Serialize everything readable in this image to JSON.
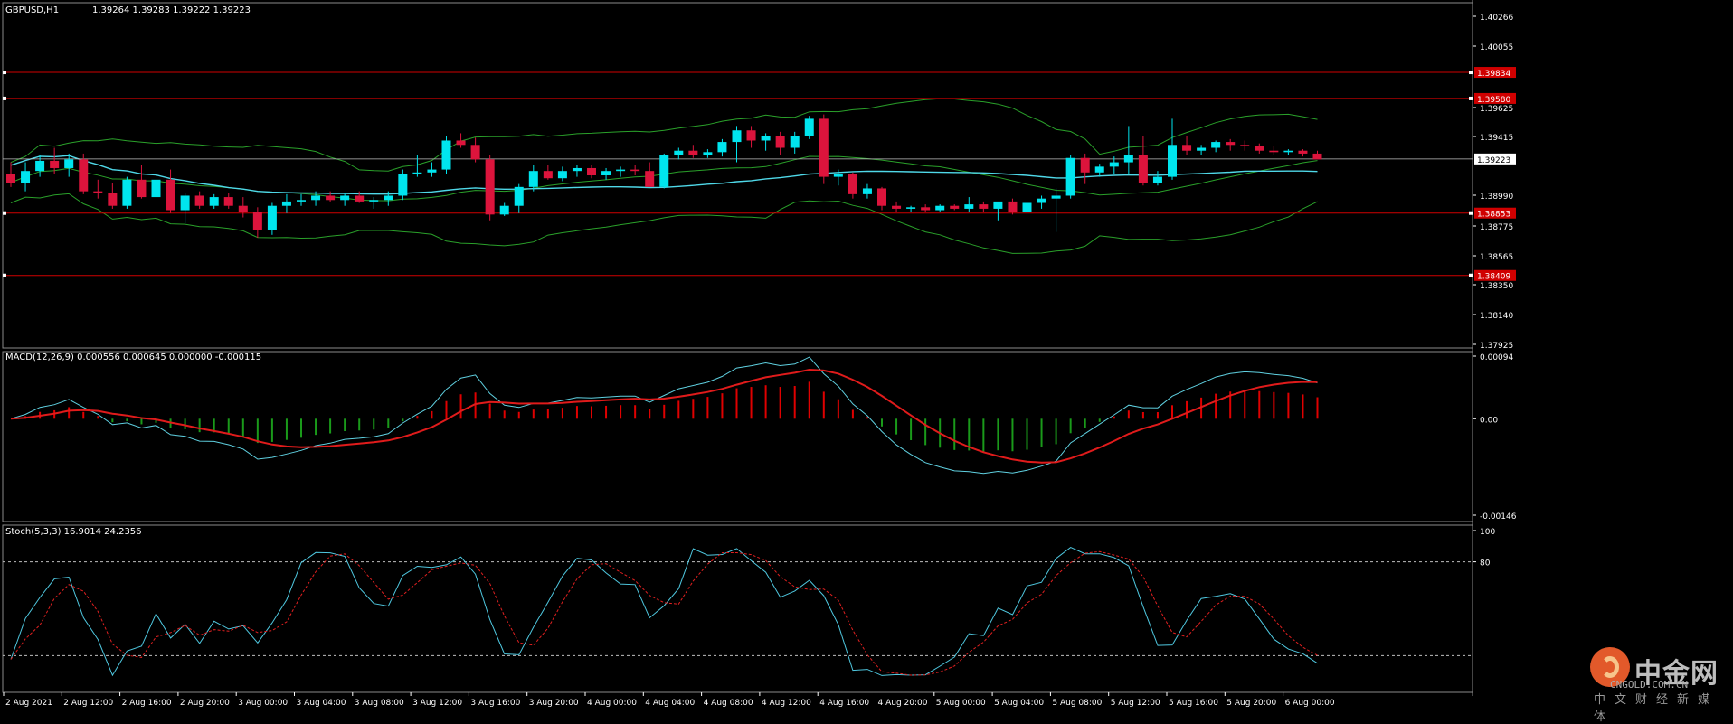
{
  "colors": {
    "background": "#000000",
    "bull": "#00e5ee",
    "bear": "#dc143c",
    "grid": "#1c1c1c",
    "bands": "#2aa02a",
    "ma": "#4fd8e8",
    "level": "#d00000",
    "price_line": "#c0c0c0",
    "macd_line": "#5fd0e0",
    "signal_line": "#e01b1b",
    "hist_pos": "#e00000",
    "hist_neg": "#1a9a1a",
    "stoch_main": "#4fc8e0",
    "stoch_signal": "#e02020"
  },
  "main_header": {
    "symbol": "GBPUSD,H1",
    "ohlc": "1.39264 1.39283 1.39222 1.39223"
  },
  "price_axis": {
    "ticks": [
      "1.40266",
      "1.40055",
      "1.39625",
      "1.39415",
      "1.38990",
      "1.38775",
      "1.38565",
      "1.38350",
      "1.38140",
      "1.37925"
    ],
    "current": "1.39223"
  },
  "levels": [
    {
      "value": 1.3982,
      "label": "1.39834"
    },
    {
      "value": 1.3964,
      "label": "1.39580"
    },
    {
      "value": 1.3885,
      "label": "1.38853"
    },
    {
      "value": 1.3842,
      "label": "1.38409"
    }
  ],
  "macd_header": {
    "label": "MACD(12,26,9) 0.000556 0.000645 0.000000 -0.000115"
  },
  "macd_axis": {
    "ticks": [
      "0.00094",
      "0.00",
      "-0.00146"
    ]
  },
  "stoch_header": {
    "label": "Stoch(5,3,3) 16.9014 24.2356"
  },
  "stoch_axis": {
    "ticks": [
      "100",
      "80"
    ]
  },
  "time_axis": {
    "labels": [
      "2 Aug 2021",
      "2 Aug 12:00",
      "2 Aug 16:00",
      "2 Aug 20:00",
      "3 Aug 00:00",
      "3 Aug 04:00",
      "3 Aug 08:00",
      "3 Aug 12:00",
      "3 Aug 16:00",
      "3 Aug 20:00",
      "4 Aug 00:00",
      "4 Aug 04:00",
      "4 Aug 08:00",
      "4 Aug 12:00",
      "4 Aug 16:00",
      "4 Aug 20:00",
      "5 Aug 00:00",
      "5 Aug 04:00",
      "5 Aug 08:00",
      "5 Aug 12:00",
      "5 Aug 16:00",
      "5 Aug 20:00",
      "6 Aug 00:00"
    ]
  },
  "watermark": {
    "brand": "中金网",
    "domain": "CNGOLD.COM.CN",
    "tag": "中文财经新媒体"
  },
  "chart_data": {
    "type": "candlestick",
    "symbol": "GBPUSD",
    "timeframe": "H1",
    "ylim": [
      1.3792,
      1.403
    ],
    "candles": [
      [
        1.3912,
        1.392,
        1.3903,
        1.3906
      ],
      [
        1.3906,
        1.392,
        1.39,
        1.3914
      ],
      [
        1.3914,
        1.3925,
        1.391,
        1.3921
      ],
      [
        1.3921,
        1.393,
        1.3912,
        1.3916
      ],
      [
        1.3916,
        1.3926,
        1.391,
        1.3922
      ],
      [
        1.3922,
        1.3926,
        1.3898,
        1.39
      ],
      [
        1.39,
        1.3908,
        1.3895,
        1.3899
      ],
      [
        1.3899,
        1.3906,
        1.3888,
        1.389
      ],
      [
        1.389,
        1.391,
        1.3888,
        1.3908
      ],
      [
        1.3908,
        1.3918,
        1.3895,
        1.3896
      ],
      [
        1.3896,
        1.3915,
        1.3892,
        1.3908
      ],
      [
        1.3908,
        1.3915,
        1.3885,
        1.3887
      ],
      [
        1.3887,
        1.3899,
        1.3878,
        1.3897
      ],
      [
        1.3897,
        1.39,
        1.3888,
        1.389
      ],
      [
        1.389,
        1.3898,
        1.3888,
        1.3896
      ],
      [
        1.3896,
        1.3899,
        1.3888,
        1.389
      ],
      [
        1.389,
        1.3896,
        1.3882,
        1.3886
      ],
      [
        1.3886,
        1.3889,
        1.3868,
        1.3873
      ],
      [
        1.3873,
        1.3892,
        1.387,
        1.389
      ],
      [
        1.389,
        1.3898,
        1.3885,
        1.3893
      ],
      [
        1.3893,
        1.3898,
        1.389,
        1.3894
      ],
      [
        1.3894,
        1.39,
        1.389,
        1.3897
      ],
      [
        1.3897,
        1.39,
        1.3893,
        1.3894
      ],
      [
        1.3894,
        1.3899,
        1.389,
        1.3897
      ],
      [
        1.3897,
        1.39,
        1.3892,
        1.3893
      ],
      [
        1.3893,
        1.3896,
        1.3888,
        1.3894
      ],
      [
        1.3894,
        1.39,
        1.389,
        1.3897
      ],
      [
        1.3897,
        1.3915,
        1.3894,
        1.3912
      ],
      [
        1.3912,
        1.3925,
        1.391,
        1.3913
      ],
      [
        1.3913,
        1.392,
        1.391,
        1.3915
      ],
      [
        1.3915,
        1.3938,
        1.3912,
        1.3935
      ],
      [
        1.3935,
        1.394,
        1.393,
        1.3932
      ],
      [
        1.3932,
        1.3937,
        1.392,
        1.3922
      ],
      [
        1.3922,
        1.3925,
        1.388,
        1.3884
      ],
      [
        1.3884,
        1.3892,
        1.3883,
        1.389
      ],
      [
        1.389,
        1.3905,
        1.3885,
        1.3903
      ],
      [
        1.3903,
        1.3918,
        1.39,
        1.3914
      ],
      [
        1.3914,
        1.3918,
        1.3908,
        1.3909
      ],
      [
        1.3909,
        1.3917,
        1.3907,
        1.3914
      ],
      [
        1.3914,
        1.3918,
        1.391,
        1.3916
      ],
      [
        1.3916,
        1.3918,
        1.3909,
        1.3911
      ],
      [
        1.3911,
        1.3916,
        1.3908,
        1.3914
      ],
      [
        1.3914,
        1.3917,
        1.391,
        1.3915
      ],
      [
        1.3915,
        1.3918,
        1.3911,
        1.3914
      ],
      [
        1.3914,
        1.392,
        1.3903,
        1.3903
      ],
      [
        1.3903,
        1.3926,
        1.3902,
        1.3925
      ],
      [
        1.3925,
        1.393,
        1.3922,
        1.3928
      ],
      [
        1.3928,
        1.3932,
        1.3923,
        1.3925
      ],
      [
        1.3925,
        1.3929,
        1.3923,
        1.3927
      ],
      [
        1.3927,
        1.3936,
        1.3924,
        1.3934
      ],
      [
        1.3934,
        1.3945,
        1.392,
        1.3942
      ],
      [
        1.3942,
        1.3945,
        1.393,
        1.3935
      ],
      [
        1.3935,
        1.394,
        1.3928,
        1.3938
      ],
      [
        1.3938,
        1.3941,
        1.3925,
        1.393
      ],
      [
        1.393,
        1.3941,
        1.3926,
        1.3938
      ],
      [
        1.3938,
        1.3952,
        1.3936,
        1.395
      ],
      [
        1.395,
        1.3953,
        1.3905,
        1.391
      ],
      [
        1.391,
        1.3915,
        1.3904,
        1.3912
      ],
      [
        1.3912,
        1.3913,
        1.3895,
        1.3898
      ],
      [
        1.3898,
        1.3905,
        1.3895,
        1.3902
      ],
      [
        1.3902,
        1.3903,
        1.3887,
        1.389
      ],
      [
        1.389,
        1.3893,
        1.3886,
        1.3888
      ],
      [
        1.3888,
        1.389,
        1.3886,
        1.3889
      ],
      [
        1.3889,
        1.3891,
        1.3886,
        1.3887
      ],
      [
        1.3887,
        1.3891,
        1.3886,
        1.389
      ],
      [
        1.389,
        1.3891,
        1.3887,
        1.3888
      ],
      [
        1.3888,
        1.3896,
        1.3886,
        1.3891
      ],
      [
        1.3891,
        1.3893,
        1.3886,
        1.3888
      ],
      [
        1.3888,
        1.3892,
        1.388,
        1.3893
      ],
      [
        1.3893,
        1.3895,
        1.3884,
        1.3886
      ],
      [
        1.3886,
        1.3893,
        1.3884,
        1.3892
      ],
      [
        1.3892,
        1.3897,
        1.3888,
        1.3895
      ],
      [
        1.3895,
        1.3902,
        1.3872,
        1.3897
      ],
      [
        1.3897,
        1.3925,
        1.3895,
        1.3923
      ],
      [
        1.3923,
        1.3926,
        1.3905,
        1.3913
      ],
      [
        1.3913,
        1.3919,
        1.391,
        1.3917
      ],
      [
        1.3917,
        1.3924,
        1.3912,
        1.392
      ],
      [
        1.392,
        1.3945,
        1.3912,
        1.3925
      ],
      [
        1.3925,
        1.3938,
        1.3904,
        1.3906
      ],
      [
        1.3906,
        1.3914,
        1.3904,
        1.391
      ],
      [
        1.391,
        1.395,
        1.3908,
        1.3932
      ],
      [
        1.3932,
        1.3938,
        1.3925,
        1.3928
      ],
      [
        1.3928,
        1.3932,
        1.3925,
        1.393
      ],
      [
        1.393,
        1.3935,
        1.3927,
        1.3934
      ],
      [
        1.3934,
        1.3936,
        1.3928,
        1.3932
      ],
      [
        1.3932,
        1.3935,
        1.3928,
        1.3931
      ],
      [
        1.3931,
        1.3933,
        1.3926,
        1.3928
      ],
      [
        1.3928,
        1.3931,
        1.3925,
        1.3927
      ],
      [
        1.3927,
        1.3929,
        1.3925,
        1.3928
      ],
      [
        1.3928,
        1.3929,
        1.3924,
        1.3926
      ],
      [
        1.3926,
        1.3928,
        1.3922,
        1.3922
      ]
    ],
    "levels": [
      1.3982,
      1.3964,
      1.3885,
      1.3842
    ],
    "macd": {
      "ylim": [
        -0.0015,
        0.00098
      ]
    },
    "stoch": {
      "ylim": [
        0,
        100
      ],
      "levels": [
        80,
        20
      ]
    }
  }
}
